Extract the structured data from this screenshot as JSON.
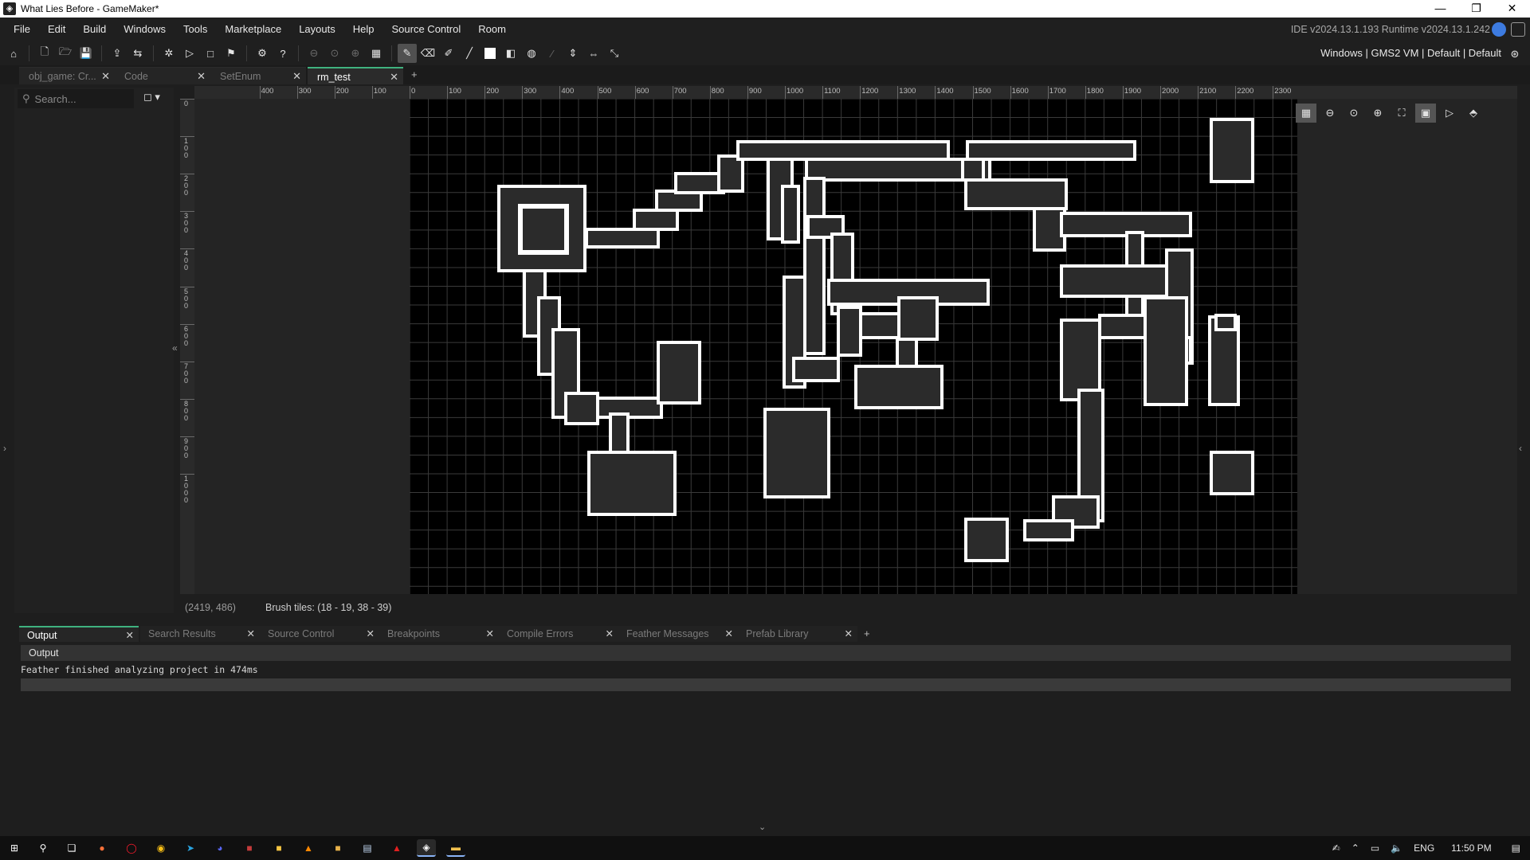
{
  "window": {
    "title": "What Lies Before - GameMaker*",
    "controls": [
      "—",
      "❐",
      "✕"
    ]
  },
  "menu": {
    "items": [
      "File",
      "Edit",
      "Build",
      "Windows",
      "Tools",
      "Marketplace",
      "Layouts",
      "Help",
      "Source Control",
      "Room"
    ],
    "version": "IDE v2024.13.1.193  Runtime v2024.13.1.242"
  },
  "toolbar": {
    "targets": "Windows  |  GMS2 VM  |  Default  |  Default"
  },
  "tabs": [
    {
      "label": "obj_game: Cr...",
      "active": false
    },
    {
      "label": "Code",
      "active": false
    },
    {
      "label": "SetEnum",
      "active": false
    },
    {
      "label": "rm_test",
      "active": true
    }
  ],
  "add_tab": "+",
  "left_panel": {
    "search_placeholder": "Search..."
  },
  "rulers": {
    "top_labels": [
      "400",
      "300",
      "200",
      "100",
      "0",
      "100",
      "200",
      "300",
      "400",
      "500",
      "600",
      "700",
      "800",
      "900",
      "1000",
      "1100",
      "1200",
      "1300",
      "1400",
      "1500",
      "1600",
      "1700",
      "1800",
      "1900",
      "2000",
      "2100",
      "2200",
      "2300"
    ],
    "left_labels": [
      "0",
      "100",
      "200",
      "300",
      "400",
      "500",
      "600",
      "700",
      "800",
      "900",
      "1000"
    ]
  },
  "status": {
    "coords": "(2419, 486)",
    "brush": "Brush tiles: (18 - 19, 38 - 39)"
  },
  "output": {
    "tabs": [
      "Output",
      "Search Results",
      "Source Control",
      "Breakpoints",
      "Compile Errors",
      "Feather Messages",
      "Prefab Library"
    ],
    "header": "Output",
    "line": "Feather finished analyzing project in 474ms"
  },
  "taskbar": {
    "language": "ENG",
    "time": "11:50 PM"
  },
  "colors": {
    "accent": "#3fb27f",
    "room_background": "#000000",
    "tile_fill": "#2b2b2b",
    "tile_outline": "#ffffff"
  }
}
